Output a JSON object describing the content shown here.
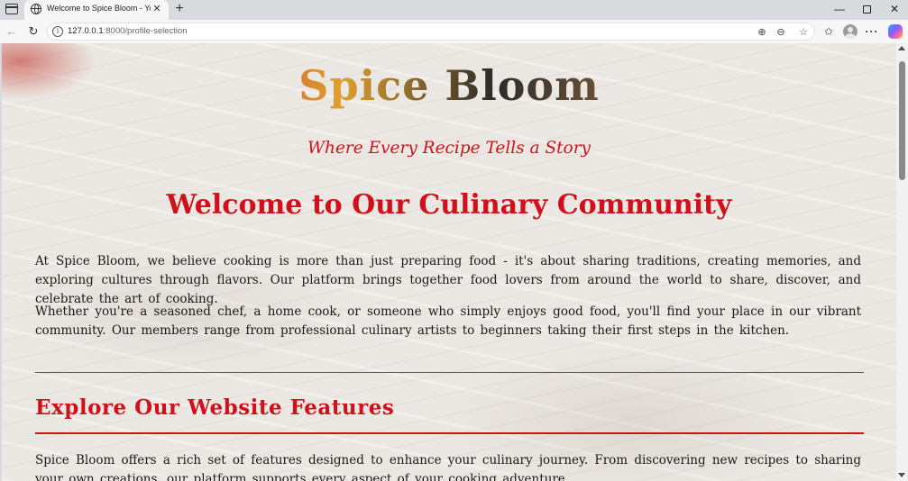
{
  "browser": {
    "tab_title": "Welcome to Spice Bloom - Your C",
    "tab_close": "✕",
    "new_tab": "+",
    "window": {
      "minimize": "—",
      "close": "✕"
    },
    "nav": {
      "back": "←",
      "reload": "↻"
    },
    "address": {
      "host": "127.0.0.1",
      "rest": ":8000/profile-selection"
    },
    "icons": {
      "zoom": "⊕",
      "share": "⊖",
      "star": "☆",
      "favorites": "✩",
      "more": "···"
    }
  },
  "page": {
    "logo": "Spice Bloom",
    "tagline": "Where Every Recipe Tells a Story",
    "heading": "Welcome to Our Culinary Community",
    "paragraphs": [
      "At Spice Bloom, we believe cooking is more than just preparing food - it's about sharing traditions, creating memories, and exploring cultures through flavors. Our platform brings together food lovers from around the world to share, discover, and celebrate the art of cooking.",
      "Whether you're a seasoned chef, a home cook, or someone who simply enjoys good food, you'll find your place in our vibrant community. Our members range from professional culinary artists to beginners taking their first steps in the kitchen."
    ],
    "features": {
      "title": "Explore Our Website Features",
      "intro": "Spice Bloom offers a rich set of features designed to enhance your culinary journey. From discovering new recipes to sharing your own creations, our platform supports every aspect of your cooking adventure."
    }
  },
  "colors": {
    "accent_red": "#d0101a",
    "body_text": "#1a1a1a"
  }
}
